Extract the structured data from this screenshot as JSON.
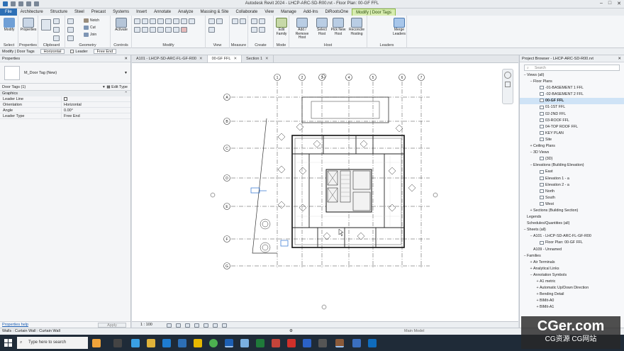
{
  "window": {
    "title": "Autodesk Revit 2024 - LHCP-ARC-SD-R00.rvt - Floor Plan: 00-GF FFL"
  },
  "ribbon_tabs": [
    "File",
    "Architecture",
    "Structure",
    "Steel",
    "Precast",
    "Systems",
    "Insert",
    "Annotate",
    "Analyze",
    "Massing & Site",
    "Collaborate",
    "View",
    "Manage",
    "Add-Ins",
    "DiRootsOne",
    "Modify | Door Tags"
  ],
  "ribbon": {
    "select": {
      "button": "Modify",
      "label": "Select"
    },
    "properties": {
      "button": "Properties",
      "label": "Properties"
    },
    "clipboard": {
      "label": "Clipboard"
    },
    "geometry": {
      "notch": "Notch",
      "cut": "Cut",
      "join": "Join",
      "label": "Geometry"
    },
    "controls": {
      "activate": "Activate",
      "label": "Controls"
    },
    "modify": {
      "label": "Modify"
    },
    "view": {
      "label": "View"
    },
    "measure": {
      "label": "Measure"
    },
    "create": {
      "label": "Create"
    },
    "mode": {
      "edit_family": "Edit Family",
      "label": "Mode"
    },
    "host": {
      "add_remove": "Add / Remove Host",
      "select_host": "Select Host",
      "pick_new": "Pick New Host",
      "reconcile": "Reconcile Hosting",
      "label": "Host"
    },
    "leaders": {
      "merge": "Merge Leaders",
      "label": "Leaders"
    }
  },
  "options_bar": {
    "context": "Modify | Door Tags",
    "orientation": "Horizontal",
    "leader_label": "Leader",
    "leader_mode": "Free End"
  },
  "properties": {
    "header": "Properties",
    "type_name": "M_Door Tag (New)",
    "filter": "Door Tags (1)",
    "edit_type": "Edit Type",
    "section": "Graphics",
    "rows": [
      {
        "key": "Leader Line",
        "value": ""
      },
      {
        "key": "Orientation",
        "value": "Horizontal"
      },
      {
        "key": "Angle",
        "value": "0.00°"
      },
      {
        "key": "Leader Type",
        "value": "Free End"
      }
    ],
    "help_link": "Properties help",
    "apply": "Apply"
  },
  "view_tabs": [
    {
      "label": "A101 - LHCP-SD-ARC-FL-GF-R00",
      "active": false
    },
    {
      "label": "00-GF FFL",
      "active": true
    },
    {
      "label": "Section 1",
      "active": false
    }
  ],
  "view_control": {
    "scale": "1 : 100"
  },
  "grid_bubbles": {
    "top": [
      "1",
      "2",
      "3",
      "4",
      "5",
      "6",
      "7"
    ],
    "left": [
      "A",
      "B",
      "C",
      "D",
      "E",
      "F",
      "G"
    ]
  },
  "browser": {
    "header": "Project Browser - LHCP-ARC-SD-R00.rvt",
    "search_placeholder": "Search",
    "tree": [
      {
        "label": "Views (all)",
        "level": 0,
        "exp": "−"
      },
      {
        "label": "Floor Plans",
        "level": 1,
        "exp": "−"
      },
      {
        "label": "-01-BASEMENT 1 FFL",
        "level": 2,
        "exp": ""
      },
      {
        "label": "-02-BASEMENT 2 FFL",
        "level": 2,
        "exp": ""
      },
      {
        "label": "00-GF FFL",
        "level": 2,
        "exp": "",
        "selected": true
      },
      {
        "label": "01-1ST FFL",
        "level": 2,
        "exp": ""
      },
      {
        "label": "02-2ND FFL",
        "level": 2,
        "exp": ""
      },
      {
        "label": "03-ROOF FFL",
        "level": 2,
        "exp": ""
      },
      {
        "label": "04-TOP ROOF FFL",
        "level": 2,
        "exp": ""
      },
      {
        "label": "KEY PLAN",
        "level": 2,
        "exp": ""
      },
      {
        "label": "Site",
        "level": 2,
        "exp": ""
      },
      {
        "label": "Ceiling Plans",
        "level": 1,
        "exp": "+"
      },
      {
        "label": "3D Views",
        "level": 1,
        "exp": "−"
      },
      {
        "label": "{3D}",
        "level": 2,
        "exp": ""
      },
      {
        "label": "Elevations (Building Elevation)",
        "level": 1,
        "exp": "−"
      },
      {
        "label": "East",
        "level": 2,
        "exp": ""
      },
      {
        "label": "Elevation 1 - a",
        "level": 2,
        "exp": ""
      },
      {
        "label": "Elevation 2 - a",
        "level": 2,
        "exp": ""
      },
      {
        "label": "North",
        "level": 2,
        "exp": ""
      },
      {
        "label": "South",
        "level": 2,
        "exp": ""
      },
      {
        "label": "West",
        "level": 2,
        "exp": ""
      },
      {
        "label": "Sections (Building Section)",
        "level": 1,
        "exp": "+"
      },
      {
        "label": "Legends",
        "level": 0,
        "exp": ""
      },
      {
        "label": "Schedules/Quantities (all)",
        "level": 0,
        "exp": ""
      },
      {
        "label": "Sheets (all)",
        "level": 0,
        "exp": "−"
      },
      {
        "label": "A101 - LHCP-SD-ARC-FL-GF-R00",
        "level": 1,
        "exp": "−"
      },
      {
        "label": "Floor Plan: 00-GF FFL",
        "level": 2,
        "exp": ""
      },
      {
        "label": "A109 - Unnamed",
        "level": 1,
        "exp": ""
      },
      {
        "label": "Families",
        "level": 0,
        "exp": "−"
      },
      {
        "label": "Air Terminals",
        "level": 1,
        "exp": "+"
      },
      {
        "label": "Analytical Links",
        "level": 1,
        "exp": "+"
      },
      {
        "label": "Annotation Symbols",
        "level": 1,
        "exp": "−"
      },
      {
        "label": "A1 metric",
        "level": 2,
        "exp": "+"
      },
      {
        "label": "Automatic Up/Down Direction",
        "level": 2,
        "exp": "+"
      },
      {
        "label": "Bending Detail",
        "level": 2,
        "exp": "+"
      },
      {
        "label": "BIMit-A0",
        "level": 2,
        "exp": "+"
      },
      {
        "label": "BIMit-A1",
        "level": 2,
        "exp": "+"
      }
    ]
  },
  "status_bar": {
    "message": "Walls : Curtain Wall : Curtain Wall",
    "model": "Main Model"
  },
  "taskbar": {
    "search_placeholder": "Type here to search"
  },
  "watermark": {
    "line1": "CGer.com",
    "line2": "CG资源 CG网站"
  },
  "colors": {
    "file_tab": "#2d6fb5",
    "context_tab": "#d7ecb0",
    "selection": "#cfe3f6",
    "taskbar": "#1f2b38"
  }
}
